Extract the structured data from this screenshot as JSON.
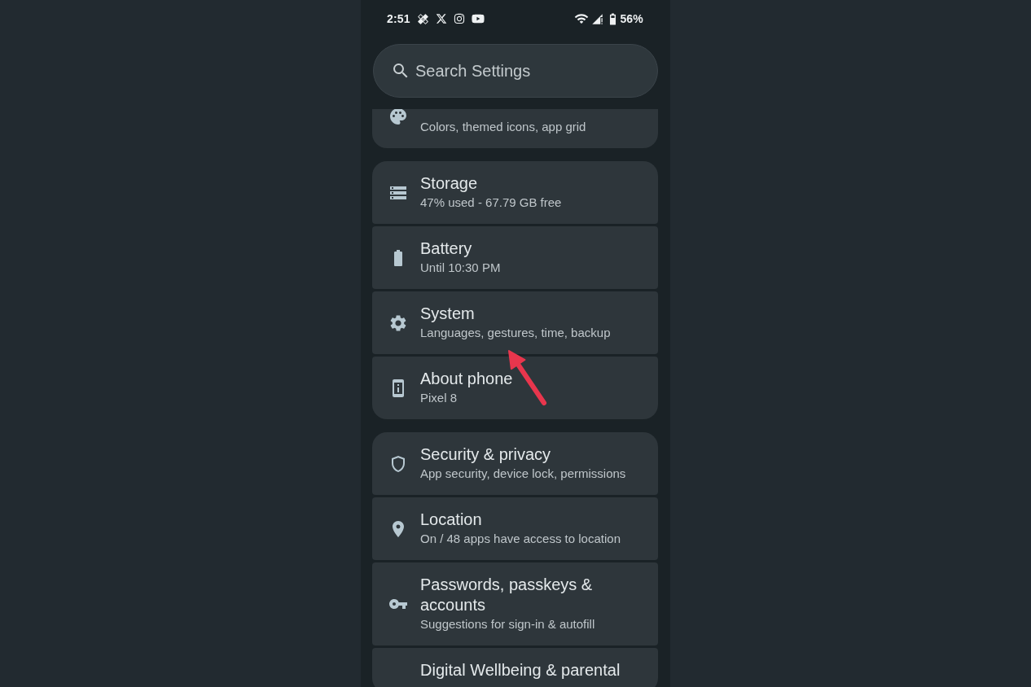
{
  "status_bar": {
    "time": "2:51",
    "battery": "56%"
  },
  "search": {
    "placeholder": "Search Settings"
  },
  "groups": [
    {
      "items": [
        {
          "subtitle": "Colors, themed icons, app grid"
        }
      ]
    },
    {
      "items": [
        {
          "title": "Storage",
          "subtitle": "47% used - 67.79 GB free"
        },
        {
          "title": "Battery",
          "subtitle": "Until 10:30 PM"
        },
        {
          "title": "System",
          "subtitle": "Languages, gestures, time, backup"
        },
        {
          "title": "About phone",
          "subtitle": "Pixel 8"
        }
      ]
    },
    {
      "items": [
        {
          "title": "Security & privacy",
          "subtitle": "App security, device lock, permissions"
        },
        {
          "title": "Location",
          "subtitle": "On / 48 apps have access to location"
        },
        {
          "title": "Passwords, passkeys & accounts",
          "subtitle": "Suggestions for sign-in & autofill"
        },
        {
          "title": "Digital Wellbeing & parental"
        }
      ]
    }
  ]
}
